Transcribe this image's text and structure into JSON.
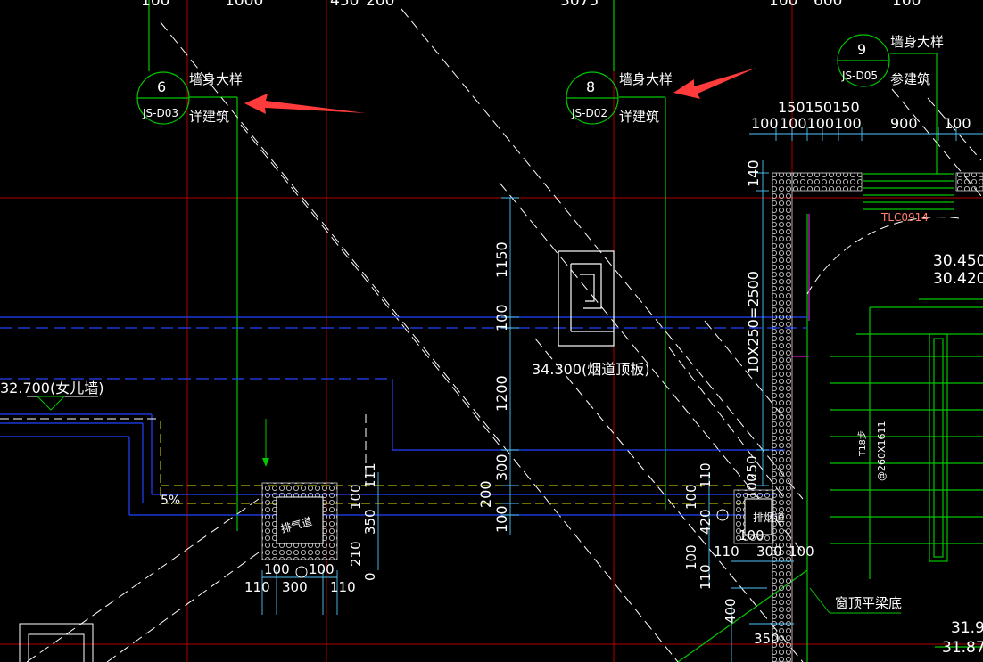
{
  "viewport": {
    "title": "CAD drawing viewport"
  },
  "colors": {
    "background": "#000000",
    "white": "#ffffff",
    "green": "#00c800",
    "cyan": "#4fc3f7",
    "blue": "#2244ff",
    "red": "#c00000",
    "yellow": "#e0e000",
    "magenta": "#d020d0",
    "salmon": "#ff7f6a",
    "arrow": "#ff3b3b"
  },
  "top_dimensions": [
    "100",
    "1000",
    "450",
    "200",
    "3075",
    "100",
    "600",
    "100"
  ],
  "callouts": [
    {
      "id": "6",
      "ref": "JS-D03",
      "title": "墙身大样",
      "note": "详建筑"
    },
    {
      "id": "8",
      "ref": "JS-D02",
      "title": "墙身大样",
      "note": "详建筑"
    },
    {
      "id": "9",
      "ref": "JS-D05",
      "title": "墙身大样",
      "note": "参建筑"
    }
  ],
  "right_top_dims": {
    "row1": "150150150",
    "row2": [
      "100",
      "100100100",
      "900",
      "100"
    ]
  },
  "tag": "TLC0914",
  "elevations": {
    "e1": "30.450",
    "e2": "30.420",
    "e3": "31.9",
    "e4": "31.87"
  },
  "vertical_dims": {
    "d1": "1150",
    "d2": "100",
    "d3": "1200",
    "d4": "300",
    "d5": "200",
    "d6": "100",
    "stair": "10X250=2500",
    "s140": "140"
  },
  "annotation_chimney": "34.300(烟道顶板)",
  "annotation_parapet": "32.700(女儿墙)",
  "slope": "5%",
  "duct_labels": {
    "left": "排气道",
    "right": "排烟道"
  },
  "left_duct_dims": {
    "v111": "111",
    "v100": "100",
    "v350": "350",
    "v210": "210",
    "v0": "0",
    "h100a": "100",
    "h100b": "100",
    "h110a": "110",
    "h300": "300",
    "h110b": "110"
  },
  "right_duct_dims": {
    "v110": "110",
    "v420": "420",
    "v100": "100",
    "v110b": "110",
    "v250": "250",
    "v100b": "100",
    "h100": "100",
    "h110": "110",
    "h300": "300",
    "h100b": "100",
    "v400": "400",
    "h350": "350"
  },
  "stair_text": {
    "t18": "T18步",
    "size": "@260X1611"
  },
  "window_beam": "窗顶平梁底"
}
